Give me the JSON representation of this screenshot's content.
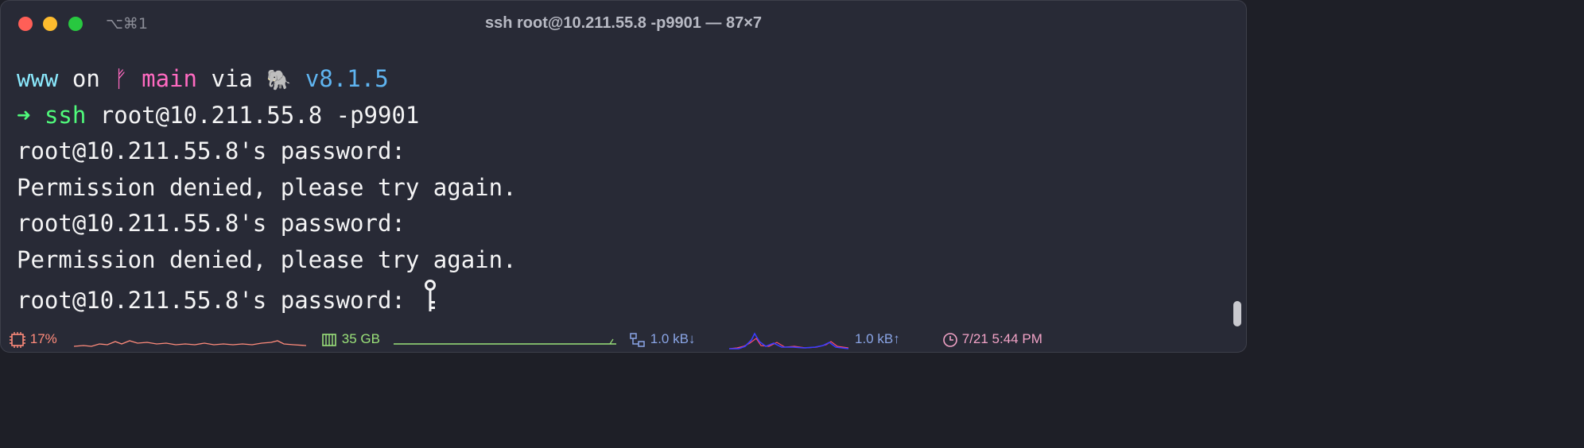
{
  "window": {
    "shortcut": "⌥⌘1",
    "title": "ssh root@10.211.55.8 -p9901 — 87×7"
  },
  "prompt": {
    "dir": "www",
    "on": "on",
    "branch_symbol": "ᚠ",
    "branch": "main",
    "via": "via",
    "php_icon": "🐘",
    "version": "v8.1.5",
    "arrow": "➜",
    "cmd": "ssh",
    "args": "root@10.211.55.8 -p9901"
  },
  "output": [
    "root@10.211.55.8's password:",
    "Permission denied, please try again.",
    "root@10.211.55.8's password:",
    "Permission denied, please try again.",
    "root@10.211.55.8's password: "
  ],
  "status": {
    "cpu": "17%",
    "memory": "35 GB",
    "net_down": "1.0 kB↓",
    "net_up": "1.0 kB↑",
    "clock": "7/21 5:44 PM"
  },
  "colors": {
    "background": "#282a36",
    "cyan": "#8be9fd",
    "pink": "#ff6ac1",
    "blue": "#5fb4f0",
    "green": "#50fa7b",
    "cpu": "#ff8b7b",
    "memory": "#9be27a",
    "network": "#8aa5e6",
    "clock": "#f2a3c7"
  },
  "icons": [
    "cpu-icon",
    "memory-icon",
    "network-icon",
    "clock-icon",
    "key-icon"
  ]
}
